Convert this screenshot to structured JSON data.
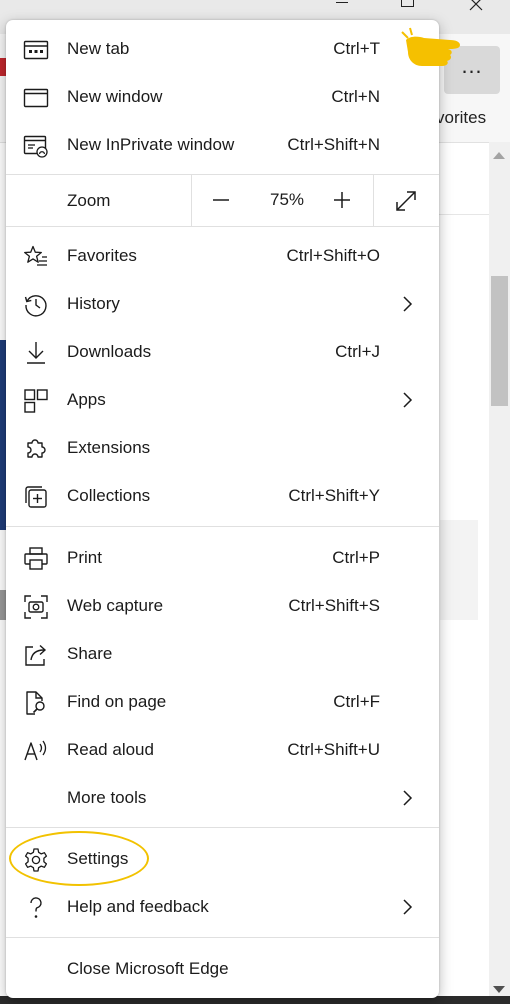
{
  "browser": {
    "favorites_bar_label": "vorites",
    "more_button_label": "…"
  },
  "menu": {
    "new_tab": {
      "label": "New tab",
      "shortcut": "Ctrl+T"
    },
    "new_window": {
      "label": "New window",
      "shortcut": "Ctrl+N"
    },
    "new_inprivate": {
      "label": "New InPrivate window",
      "shortcut": "Ctrl+Shift+N"
    },
    "zoom": {
      "label": "Zoom",
      "value": "75%"
    },
    "favorites": {
      "label": "Favorites",
      "shortcut": "Ctrl+Shift+O"
    },
    "history": {
      "label": "History"
    },
    "downloads": {
      "label": "Downloads",
      "shortcut": "Ctrl+J"
    },
    "apps": {
      "label": "Apps"
    },
    "extensions": {
      "label": "Extensions"
    },
    "collections": {
      "label": "Collections",
      "shortcut": "Ctrl+Shift+Y"
    },
    "print": {
      "label": "Print",
      "shortcut": "Ctrl+P"
    },
    "web_capture": {
      "label": "Web capture",
      "shortcut": "Ctrl+Shift+S"
    },
    "share": {
      "label": "Share"
    },
    "find_on_page": {
      "label": "Find on page",
      "shortcut": "Ctrl+F"
    },
    "read_aloud": {
      "label": "Read aloud",
      "shortcut": "Ctrl+Shift+U"
    },
    "more_tools": {
      "label": "More tools"
    },
    "settings": {
      "label": "Settings"
    },
    "help_feedback": {
      "label": "Help and feedback"
    },
    "close_edge": {
      "label": "Close Microsoft Edge"
    }
  },
  "colors": {
    "highlight": "#f2c200",
    "pointer_hand": "#f5c000",
    "menu_bg": "#ffffff",
    "separator": "#e0e0e0"
  },
  "icons": {
    "new_tab": "new-tab-icon",
    "new_window": "window-icon",
    "new_inprivate": "inprivate-icon",
    "favorites": "star-list-icon",
    "history": "history-icon",
    "downloads": "download-icon",
    "apps": "apps-grid-icon",
    "extensions": "puzzle-icon",
    "collections": "collections-icon",
    "print": "printer-icon",
    "web_capture": "camera-capture-icon",
    "share": "share-icon",
    "find_on_page": "find-page-icon",
    "read_aloud": "read-aloud-icon",
    "settings": "gear-icon",
    "help_feedback": "question-mark-icon"
  }
}
